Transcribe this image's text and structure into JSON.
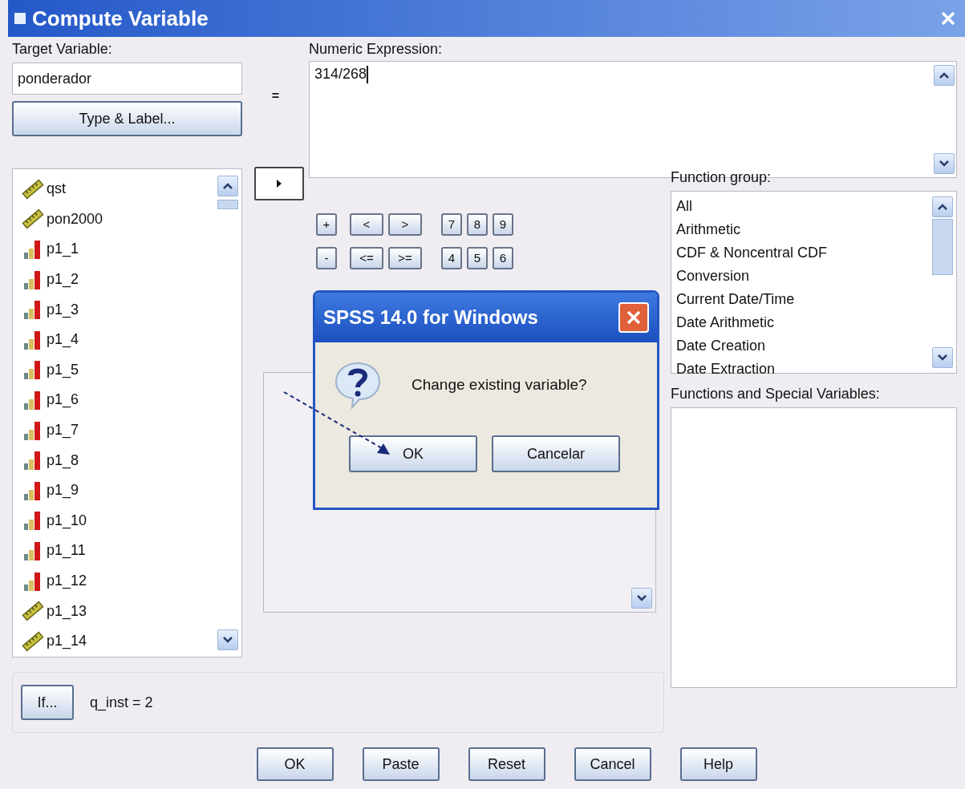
{
  "window": {
    "title": "Compute Variable"
  },
  "target_variable": {
    "label": "Target Variable:",
    "value": "ponderador"
  },
  "type_label_button": "Type & Label...",
  "equals_sign": "=",
  "numeric_expression": {
    "label": "Numeric Expression:",
    "value": "314/268"
  },
  "variables": [
    {
      "name": "qst",
      "kind": "scale"
    },
    {
      "name": "pon2000",
      "kind": "scale"
    },
    {
      "name": "p1_1",
      "kind": "ordinal"
    },
    {
      "name": "p1_2",
      "kind": "ordinal"
    },
    {
      "name": "p1_3",
      "kind": "ordinal"
    },
    {
      "name": "p1_4",
      "kind": "ordinal"
    },
    {
      "name": "p1_5",
      "kind": "ordinal"
    },
    {
      "name": "p1_6",
      "kind": "ordinal"
    },
    {
      "name": "p1_7",
      "kind": "ordinal"
    },
    {
      "name": "p1_8",
      "kind": "ordinal"
    },
    {
      "name": "p1_9",
      "kind": "ordinal"
    },
    {
      "name": "p1_10",
      "kind": "ordinal"
    },
    {
      "name": "p1_11",
      "kind": "ordinal"
    },
    {
      "name": "p1_12",
      "kind": "ordinal"
    },
    {
      "name": "p1_13",
      "kind": "scale"
    },
    {
      "name": "p1_14",
      "kind": "scale"
    }
  ],
  "keypad": [
    [
      "+",
      "<",
      ">",
      "7",
      "8",
      "9"
    ],
    [
      "-",
      "<=",
      ">=",
      "4",
      "5",
      "6"
    ]
  ],
  "function_group": {
    "label": "Function group:",
    "items": [
      "All",
      "Arithmetic",
      "CDF & Noncentral CDF",
      "Conversion",
      "Current Date/Time",
      "Date Arithmetic",
      "Date Creation",
      "Date Extraction"
    ]
  },
  "functions_label": "Functions and Special Variables:",
  "if_button": "If...",
  "if_condition": "q_inst = 2",
  "buttons": [
    "OK",
    "Paste",
    "Reset",
    "Cancel",
    "Help"
  ],
  "message_box": {
    "title": "SPSS 14.0 for Windows",
    "message": "Change existing variable?",
    "buttons": [
      "OK",
      "Cancelar"
    ]
  }
}
